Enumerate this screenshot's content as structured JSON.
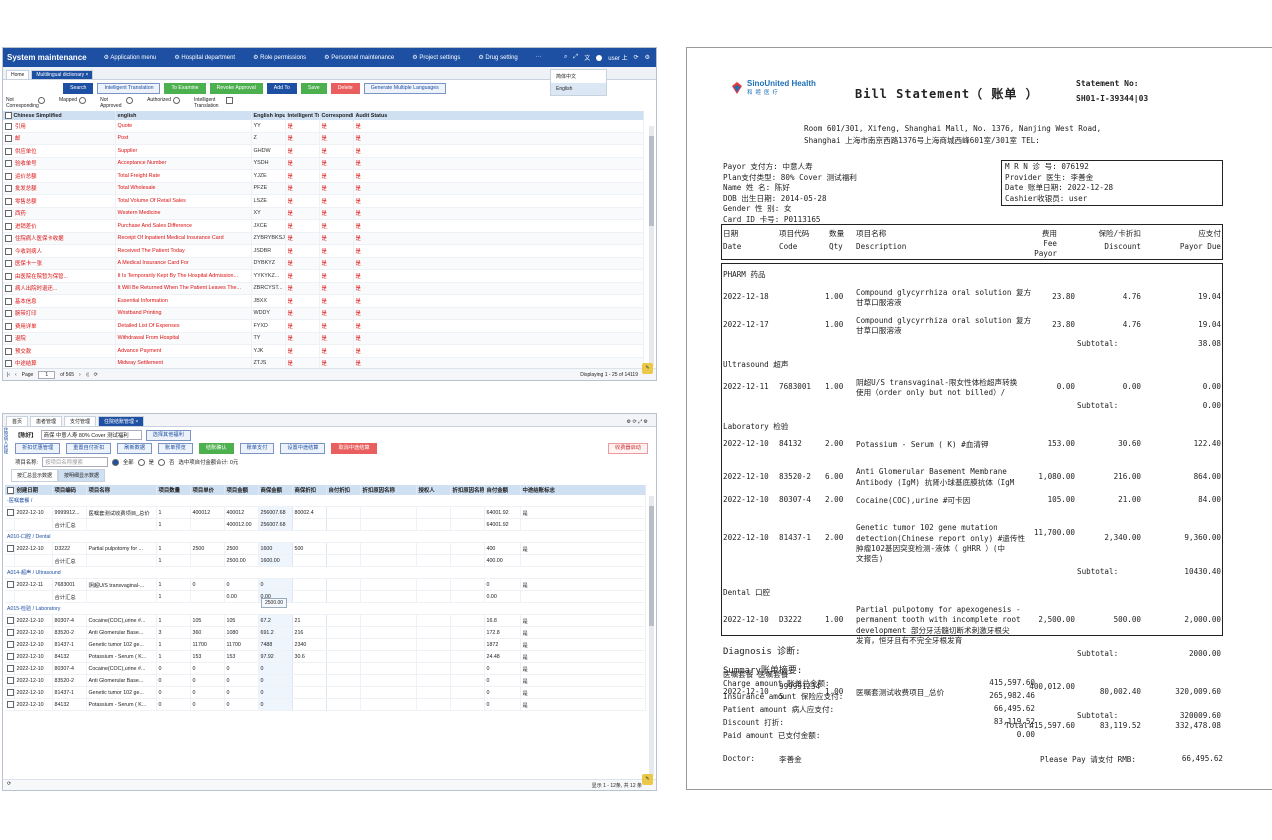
{
  "p1": {
    "app_title": "System maintenance",
    "menu": [
      "Application menu",
      "Hospital department",
      "Role permissions",
      "Personnel maintenance",
      "Project settings",
      "Drug setting",
      "···"
    ],
    "user": "user 上",
    "tabs": [
      "Home",
      "Multilingual dictionary ×"
    ],
    "lang_options": [
      "简体中文",
      "English"
    ],
    "buttons": [
      "Search",
      "Intelligent Translation",
      "To Examine",
      "Revoke Approval",
      "Add To",
      "Save",
      "Delete",
      "Generate Multiple Languages"
    ],
    "filters": [
      "Not Corresponding",
      "Mapped",
      "Not Approved",
      "Authorized",
      "Intelligent Translation"
    ],
    "columns": [
      "Chinese Simplified",
      "english",
      "English Input",
      "Intelligent Tra",
      "Correspondin",
      "Audit Status"
    ],
    "rows": [
      [
        "引用",
        "Quote",
        "YY",
        "是",
        "是",
        "是"
      ],
      [
        "邮",
        "Post",
        "Z",
        "是",
        "是",
        "是"
      ],
      [
        "供应单位",
        "Supplier",
        "GHDW",
        "是",
        "是",
        "是"
      ],
      [
        "验收单号",
        "Acceptance Number",
        "YSDH",
        "是",
        "是",
        "是"
      ],
      [
        "运价总额",
        "Total Freight Rate",
        "YJZE",
        "是",
        "是",
        "是"
      ],
      [
        "批发总额",
        "Total Wholesale",
        "PFZE",
        "是",
        "是",
        "是"
      ],
      [
        "零售总额",
        "Total Volume Of Retail Sales",
        "LSZE",
        "是",
        "是",
        "是"
      ],
      [
        "西药",
        "Western Medicine",
        "XY",
        "是",
        "是",
        "是"
      ],
      [
        "进销差价",
        "Purchase And Sales Difference",
        "JXCE",
        "是",
        "是",
        "是"
      ],
      [
        "住院病人医保卡收据",
        "Receipt Of Inpatient Medical Insurance Card",
        "ZYBRYBKSJ",
        "是",
        "是",
        "是"
      ],
      [
        "今收到病人",
        "Received The Patient Today",
        "JSDBR",
        "是",
        "是",
        "是"
      ],
      [
        "医保卡一张",
        "A Medical Insurance Card For",
        "DYBKYZ",
        "是",
        "是",
        "是"
      ],
      [
        "由医院在院暂为保管...",
        "It Is Temporarily Kept By The Hospital Admission...",
        "YYKYKZ...",
        "是",
        "是",
        "是"
      ],
      [
        "病人出院时退还...",
        "It Will Be Returned When The Patient Leaves The...",
        "ZBRCYST...",
        "是",
        "是",
        "是"
      ],
      [
        "基本信息",
        "Essential Information",
        "JBXX",
        "是",
        "是",
        "是"
      ],
      [
        "腕带打印",
        "Wristband Printing",
        "WDDY",
        "是",
        "是",
        "是"
      ],
      [
        "费用详单",
        "Detailed List Of Expenses",
        "FYXD",
        "是",
        "是",
        "是"
      ],
      [
        "退院",
        "Withdrawal From Hospital",
        "TY",
        "是",
        "是",
        "是"
      ],
      [
        "预交款",
        "Advance Payment",
        "YJK",
        "是",
        "是",
        "是"
      ],
      [
        "中途结算",
        "Midway Settlement",
        "ZTJS",
        "是",
        "是",
        "是"
      ]
    ],
    "pager": {
      "page_label": "Page",
      "page": "1",
      "of": "of 565",
      "info": "Displaying 1 - 25 of 14119"
    }
  },
  "p2": {
    "tabs": [
      "首页",
      "患者管理",
      "支付管理",
      "住院结账管理 ×"
    ],
    "side_label": "住院病人结账",
    "patient_label": "【陈好】",
    "patient_info": "商保 中意人寿 80% Cover 测试福利",
    "select_policy": "选择其他福利",
    "buttons": [
      "折扣优惠管理",
      "重置自付折扣",
      "刷新数据",
      "账单预览",
      "结账确认",
      "账单支付",
      "设置中途结算",
      "取消中途结算"
    ],
    "charge_note": "收费器启动",
    "filter_label": "项目名称:",
    "filter_placeholder": "按项目名称搜索",
    "radio_all": "全部",
    "radio_yes": "是",
    "radio_no": "否",
    "amount_label": "选中项自付金额合计: 0元",
    "view_tabs": [
      "按汇总显示数据",
      "按明细显示数据"
    ],
    "columns": [
      "",
      "创建日期",
      "项目编码",
      "项目名称",
      "项目数量",
      "项目单价",
      "项目金额",
      "商保金额",
      "商保折扣",
      "自付折扣",
      "折扣原因名称",
      "授权人",
      "折扣原因名称",
      "自付金额",
      "中途结账标志"
    ],
    "groups": [
      {
        "title": "-医嘱套餐 /",
        "rows": [
          [
            "2022-12-10",
            "9999912...",
            "医嘱套测试收费项目_总价",
            "1",
            "400012",
            "400012",
            "256007.68",
            "80002.4",
            "",
            "",
            "",
            "",
            "64001.92",
            "是"
          ],
          [
            "",
            "合计汇总",
            "",
            "1",
            "",
            "400012.00",
            "256007.68",
            "",
            "",
            "",
            "",
            "",
            "64001.92",
            ""
          ]
        ]
      },
      {
        "title": "A010-口腔 / Dental",
        "rows": [
          [
            "2022-12-10",
            "D3222",
            "Partial pulpotomy for ...",
            "1",
            "2500",
            "2500",
            "1600",
            "500",
            "",
            "",
            "",
            "",
            "400",
            "是"
          ],
          [
            "",
            "合计汇总",
            "",
            "1",
            "",
            "2500.00",
            "1600.00",
            "",
            "",
            "",
            "",
            "",
            "400.00",
            ""
          ]
        ]
      },
      {
        "title": "A014-超声 / Ultrasound",
        "rows": [
          [
            "2022-12-11",
            "7683001",
            "阴超U/S transvaginal-...",
            "1",
            "0",
            "0",
            "0",
            "",
            "",
            "",
            "",
            "",
            "0",
            "是"
          ],
          [
            "",
            "合计汇总",
            "",
            "1",
            "",
            "0.00",
            "0.00",
            "",
            "",
            "",
            "",
            "",
            "0.00",
            ""
          ]
        ]
      },
      {
        "title": "A015-检验 / Laboratory",
        "rows": [
          [
            "2022-12-10",
            "80307-4",
            "Cocaine(COC),urine #...",
            "1",
            "105",
            "105",
            "67.2",
            "21",
            "",
            "",
            "",
            "",
            "16.8",
            "是"
          ],
          [
            "2022-12-10",
            "83520-2",
            "Anti Glomerular Base...",
            "3",
            "360",
            "1080",
            "691.2",
            "216",
            "",
            "",
            "",
            "",
            "172.8",
            "是"
          ],
          [
            "2022-12-10",
            "81437-1",
            "Genetic tumor 102 ge...",
            "1",
            "11700",
            "11700",
            "7488",
            "2340",
            "",
            "",
            "",
            "",
            "1872",
            "是"
          ],
          [
            "2022-12-10",
            "84132",
            "Potassium - Serum ( K...",
            "1",
            "153",
            "153",
            "97.92",
            "30.6",
            "",
            "",
            "",
            "",
            "24.48",
            "是"
          ],
          [
            "2022-12-10",
            "80307-4",
            "Cocaine(COC),urine #...",
            "0",
            "0",
            "0",
            "0",
            "",
            "",
            "",
            "",
            "",
            "0",
            "是"
          ],
          [
            "2022-12-10",
            "83520-2",
            "Anti Glomerular Base...",
            "0",
            "0",
            "0",
            "0",
            "",
            "",
            "",
            "",
            "",
            "0",
            "是"
          ],
          [
            "2022-12-10",
            "81437-1",
            "Genetic tumor 102 ge...",
            "0",
            "0",
            "0",
            "0",
            "",
            "",
            "",
            "",
            "",
            "0",
            "是"
          ],
          [
            "2022-12-10",
            "84132",
            "Potassium - Serum ( K...",
            "0",
            "0",
            "0",
            "0",
            "",
            "",
            "",
            "",
            "",
            "0",
            "是"
          ]
        ]
      }
    ],
    "tooltip": "2500.00",
    "footer": "显示 1 - 12条, 共 12 条"
  },
  "p3": {
    "logo_en": "SinoUnited Health",
    "logo_cn": "和睦医疗",
    "title": "Bill Statement（ 账单 ）",
    "statement_label": "Statement No:",
    "statement_no": "SH01-I-39344|03",
    "address1": "Room 601/301, Xifeng, Shanghai Mall, No. 1376, Nanjing West Road,",
    "address2": "Shanghai 上海市南京西路1376号上海商城西峰601室/301室 TEL:",
    "payor": "Payor 支付方:  中意人寿",
    "plan": "Plan支付类型: 80% Cover 测试福利",
    "name": "Name   姓 名: 陈好",
    "dob": "DOB 出生日期: 2014-05-28",
    "gender": "Gender 性 别:  女",
    "card": "Card ID 卡号:  P0113165",
    "mrn": "M R N   诊 号:  076192",
    "provider": "Provider 医生:  李善金",
    "date": "Date 账单日期:   2022-12-28",
    "cashier": "Cashier收银员:  user",
    "head_cn": [
      "日期",
      "项目代码",
      "数量",
      "项目名称",
      "费用",
      "保险/卡折扣",
      "应支付"
    ],
    "head_en": [
      "Date",
      "Code",
      "Qty",
      "Description",
      "Fee Payor",
      "Discount",
      "Payor Due"
    ],
    "sections": [
      {
        "title": "PHARM 药品",
        "lines": [
          {
            "date": "2022-12-18",
            "code": "",
            "qty": "1.00",
            "desc": [
              "Compound glycyrrhiza oral solution 复方",
              "甘草口服溶液"
            ],
            "fee": "23.80",
            "disc": "4.76",
            "due": "19.04"
          },
          {
            "date": "2022-12-17",
            "code": "",
            "qty": "1.00",
            "desc": [
              "Compound glycyrrhiza oral solution 复方",
              "甘草口服溶液"
            ],
            "fee": "23.80",
            "disc": "4.76",
            "due": "19.04"
          }
        ],
        "subtotal": "38.08"
      },
      {
        "title": "Ultrasound 超声",
        "lines": [
          {
            "date": "2022-12-11",
            "code": "7683001",
            "qty": "1.00",
            "desc": [
              "阴超U/S transvaginal-限女性体检超声转换",
              "使用（order only but not billed）/"
            ],
            "fee": "0.00",
            "disc": "0.00",
            "due": "0.00"
          }
        ],
        "subtotal": "0.00"
      },
      {
        "title": "Laboratory 检验",
        "lines": [
          {
            "date": "2022-12-10",
            "code": "84132",
            "qty": "2.00",
            "desc": [
              "Potassium - Serum ( K) #血清钾"
            ],
            "fee": "153.00",
            "disc": "30.60",
            "due": "122.40"
          },
          {
            "date": "2022-12-10",
            "code": "83520-2",
            "qty": "6.00",
            "desc": [
              "Anti Glomerular Basement Membrane",
              "Antibody (IgM) 抗肾小球基底膜抗体（IgM"
            ],
            "fee": "1,080.00",
            "disc": "216.00",
            "due": "864.00"
          },
          {
            "date": "2022-12-10",
            "code": "80307-4",
            "qty": "2.00",
            "desc": [
              "Cocaine(COC),urine #可卡因"
            ],
            "fee": "105.00",
            "disc": "21.00",
            "due": "84.00"
          },
          {
            "date": "2022-12-10",
            "code": "81437-1",
            "qty": "2.00",
            "desc": [
              "Genetic tumor 102 gene mutation",
              "detection(Chinese report only) #遗传性",
              "肿瘤102基因突变检测-液体（ gHRR ）(中",
              "文报告)"
            ],
            "fee": "11,700.00",
            "disc": "2,340.00",
            "due": "9,360.00"
          }
        ],
        "subtotal": "10430.40"
      },
      {
        "title": "Dental 口腔",
        "lines": [
          {
            "date": "2022-12-10",
            "code": "D3222",
            "qty": "1.00",
            "desc": [
              "Partial pulpotomy for apexogenesis -",
              "permanent tooth with incomplete root",
              "development 部分牙活髓切断术刺激牙根尖",
              "发育，恒牙且有不完全牙根发育"
            ],
            "fee": "2,500.00",
            "disc": "500.00",
            "due": "2,000.00"
          }
        ],
        "subtotal": "2000.00"
      },
      {
        "title": "医嘱套餐 医嘱套餐",
        "lines": [
          {
            "date": "2022-12-10",
            "code": "9999912345",
            "qty": "1.00",
            "desc": [
              "医嘱套测试收费项目_总价"
            ],
            "fee": "400,012.00",
            "disc": "80,002.40",
            "due": "320,009.60"
          }
        ],
        "subtotal": "320009.60"
      }
    ],
    "subtotal_label": "Subtotal:",
    "total_label": "Total:",
    "total_fee": "415,597.60",
    "total_disc": "83,119.52",
    "total_due": "332,478.08",
    "diagnosis": "Diagnosis 诊断:",
    "summary": "Summary账单摘要:",
    "summary_rows": [
      [
        "Charge amount 账单总金额:",
        "415,597.60"
      ],
      [
        "Insurance amount 保险应支付:",
        "265,982.46"
      ],
      [
        "Patient amount 病人应支付:",
        "66,495.62"
      ],
      [
        "Discount 打折:",
        "83,119.52"
      ],
      [
        "Paid amount 已支付金额:",
        "0.00"
      ]
    ],
    "doctor_label": "Doctor:",
    "doctor": "李善金",
    "please_pay": "Please Pay 请支付 RMB:",
    "please_pay_amount": "66,495.62"
  }
}
